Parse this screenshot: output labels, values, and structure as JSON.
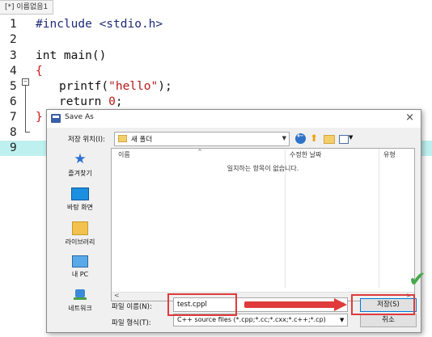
{
  "editor": {
    "tab_label": "[*] 이름없음1",
    "lines": [
      {
        "n": "1",
        "text": "#include <stdio.h>"
      },
      {
        "n": "2",
        "text": ""
      },
      {
        "n": "3",
        "text": "int main()"
      },
      {
        "n": "4",
        "text": "{"
      },
      {
        "n": "5",
        "text": "    printf(\"hello\");"
      },
      {
        "n": "6",
        "text": "    return 0;"
      },
      {
        "n": "7",
        "text": "}"
      },
      {
        "n": "8",
        "text": ""
      },
      {
        "n": "9",
        "text": ""
      }
    ],
    "code": {
      "include": "#include <stdio.h>",
      "main_decl": "int main()",
      "open_brace": "{",
      "printf_call": "printf(",
      "printf_arg": "\"hello\"",
      "printf_end": ");",
      "return_kw": "return ",
      "return_val": "0",
      "return_end": ";",
      "close_brace": "}"
    },
    "fold_marker": "−"
  },
  "dialog": {
    "title": "Save As",
    "close": "×",
    "location_label": "저장 위치(I):",
    "location_value": "새 폴더",
    "places": [
      {
        "label": "즐겨찾기",
        "icon": "star-icon"
      },
      {
        "label": "바탕 화면",
        "icon": "desktop-icon"
      },
      {
        "label": "라이브러리",
        "icon": "library-icon"
      },
      {
        "label": "내 PC",
        "icon": "pc-icon"
      },
      {
        "label": "네트워크",
        "icon": "network-icon"
      }
    ],
    "columns": {
      "name": "이름",
      "modified": "수정한 날짜",
      "type": "유형"
    },
    "empty_message": "일치하는 항목이 없습니다.",
    "filename_label": "파일 이름(N):",
    "filename_value": "test.cppl",
    "filetype_label": "파일 형식(T):",
    "filetype_value": "C++ source files (*.cpp;*.cc;*.cxx;*.c++;*.cp)",
    "save_button": "저장(S)",
    "cancel_button": "취소"
  },
  "colors": {
    "annotation_red": "#e03a3a",
    "check_green": "#46a84a",
    "current_line": "#bff0f0"
  }
}
